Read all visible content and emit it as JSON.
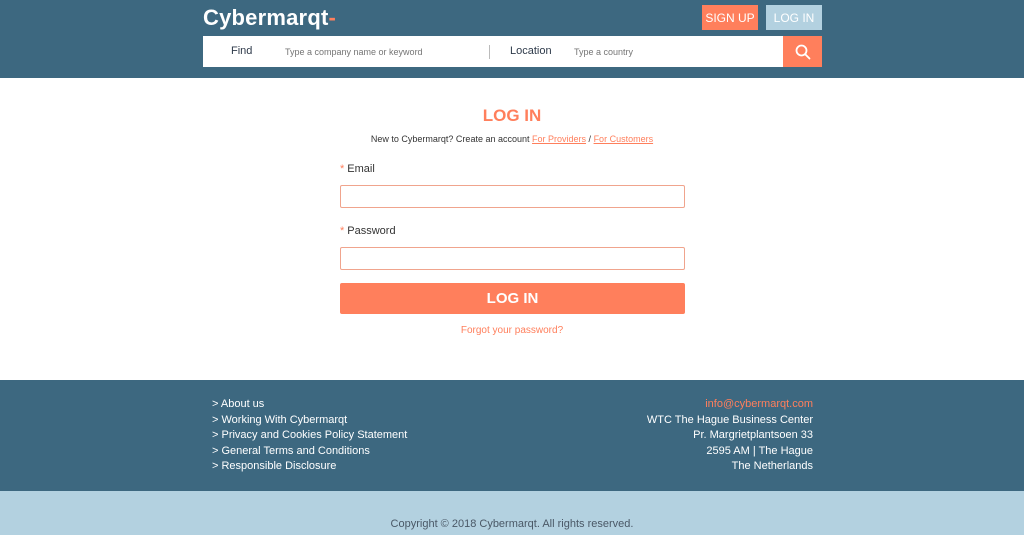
{
  "header": {
    "logo": "Cybermarqt",
    "logo_dash": "-",
    "signup_label": "SIGN UP",
    "login_label": "LOG IN"
  },
  "search": {
    "find_label": "Find",
    "find_placeholder": "Type a company name or keyword",
    "location_label": "Location",
    "location_placeholder": "Type a country",
    "icon": "search-icon"
  },
  "login": {
    "title": "LOG IN",
    "subtitle_prefix": "New to Cybermarqt? Create an account",
    "providers_link": "For Providers",
    "separator": "/",
    "customers_link": "For Customers",
    "required_mark": "*",
    "email_label": "Email",
    "password_label": "Password",
    "submit_label": "LOG IN",
    "forgot_label": "Forgot your password?"
  },
  "footer": {
    "links": [
      "> About us",
      "> Working With Cybermarqt",
      "> Privacy and Cookies Policy Statement",
      "> General Terms and Conditions",
      "> Responsible Disclosure"
    ],
    "email": "info@cybermarqt.com",
    "address": [
      "WTC The Hague Business Center",
      "Pr. Margrietplantsoen 33",
      "2595 AM | The Hague",
      "The Netherlands"
    ],
    "copyright": "Copyright © 2018 Cybermarqt. All rights reserved."
  },
  "colors": {
    "header_bg": "#3d6880",
    "accent": "#ff7f5c",
    "light_blue": "#b3d1e0"
  }
}
